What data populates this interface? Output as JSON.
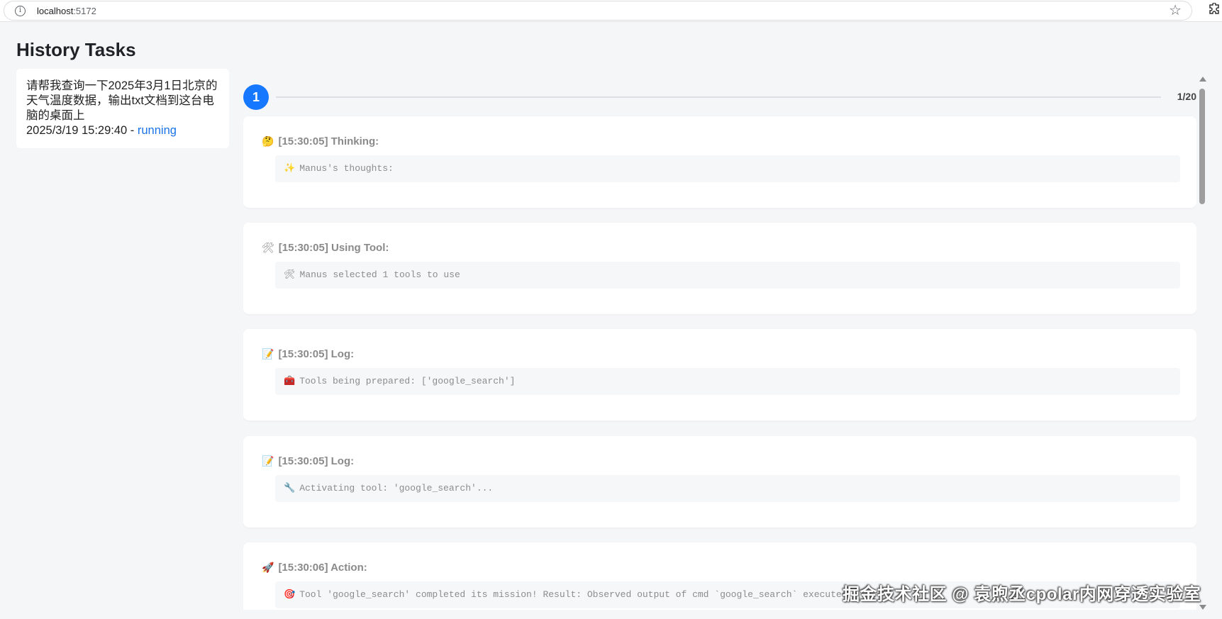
{
  "browser": {
    "url_host": "localhost",
    "url_port": ":5172"
  },
  "page": {
    "title": "History Tasks"
  },
  "task": {
    "prompt": "请帮我查询一下2025年3月1日北京的天气温度数据，输出txt文档到这台电脑的桌面上",
    "timestamp": "2025/3/19 15:29:40 - ",
    "status": "running",
    "status_color": "#1a73e8"
  },
  "steps": {
    "current": "1",
    "count": "1/20",
    "accent_color": "#1677ff"
  },
  "logs": [
    {
      "icon": "thinking-face-icon",
      "emoji": "🤔",
      "header": "[15:30:05] Thinking:",
      "body_emoji": "✨",
      "body": "Manus's thoughts:"
    },
    {
      "icon": "tools-icon",
      "emoji": "🛠",
      "header": "[15:30:05] Using Tool:",
      "body_emoji": "🛠",
      "body": "Manus selected 1 tools to use"
    },
    {
      "icon": "memo-icon",
      "emoji": "📝",
      "header": "[15:30:05] Log:",
      "body_emoji": "🧰",
      "body": "Tools being prepared: ['google_search']"
    },
    {
      "icon": "memo-icon",
      "emoji": "📝",
      "header": "[15:30:05] Log:",
      "body_emoji": "🔧",
      "body": "Activating tool: 'google_search'..."
    },
    {
      "icon": "rocket-icon",
      "emoji": "🚀",
      "header": "[15:30:06] Action:",
      "body_emoji": "🎯",
      "body": "Tool 'google_search' completed its mission! Result: Observed output of cmd `google_search` executed:"
    }
  ],
  "watermark": "掘金技术社区 @ 袁煦丞cpolar内网穿透实验室"
}
